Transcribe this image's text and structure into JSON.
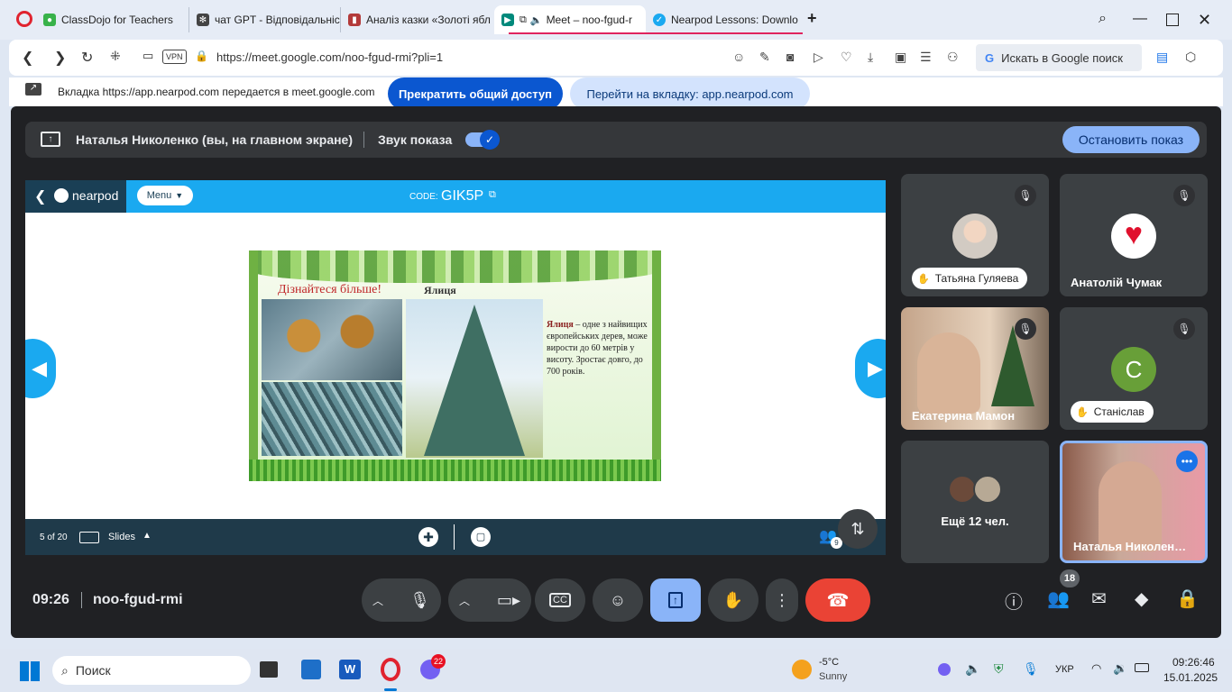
{
  "tabs": [
    {
      "title": "ClassDojo for Teachers"
    },
    {
      "title": "чат GPT - Відповідальніст"
    },
    {
      "title": "Аналіз казки «Золоті ябл"
    },
    {
      "title": "Meet – noo-fgud-r"
    },
    {
      "title": "Nearpod Lessons: Downlo"
    }
  ],
  "address": {
    "url": "https://meet.google.com/noo-fgud-rmi?pli=1",
    "vpn": "VPN",
    "search_button": "Искать в Google поиск"
  },
  "sharebar": {
    "message": "Вкладка https://app.nearpod.com передается в meet.google.com",
    "stop_label": "Прекратить общий доступ",
    "goto_label": "Перейти на вкладку: app.nearpod.com"
  },
  "presenting": {
    "label": "Наталья Николенко (вы, на главном экране)",
    "sound_label": "Звук показа",
    "stop_label": "Остановить показ"
  },
  "nearpod": {
    "logo": "nearpod",
    "menu": "Menu",
    "code_prefix": "CODE:",
    "code": "GIK5P",
    "page": "5 of 20",
    "slides": "Slides",
    "students": "9"
  },
  "slide": {
    "heading": "Дізнайтеся більше!",
    "tree_title": "Ялиця",
    "text_bold": "Ялиця",
    "text_rest": " – одне з найвищих європейських дерев, може вирости до 60 метрів у висоту. Зростає довго, до 700 років."
  },
  "participants": [
    {
      "name": "Татьяна Гуляева",
      "muted": true,
      "hand": true
    },
    {
      "name": "Анатолій Чумак",
      "muted": true,
      "hand": false
    },
    {
      "name": "Екатерина Мамон",
      "muted": true,
      "hand": false
    },
    {
      "name": "Станіслав",
      "muted": true,
      "hand": true,
      "initial": "С"
    },
    {
      "name": "Ещё 12 чел."
    },
    {
      "name": "Наталья Николен…",
      "speaking": true
    }
  ],
  "meeting": {
    "time": "09:26",
    "code": "noo-fgud-rmi",
    "people_count": "18"
  },
  "taskbar": {
    "search": "Поиск",
    "weather_temp": "-5°C",
    "weather_desc": "Sunny",
    "lang": "УКР",
    "time": "09:26:46",
    "date": "15.01.2025",
    "viber_badge": "22"
  },
  "colors": {
    "meet_bg": "#202124",
    "hangup": "#ea4335",
    "share_active": "#8ab4f8",
    "nearpod_blue": "#1aa9f0"
  }
}
